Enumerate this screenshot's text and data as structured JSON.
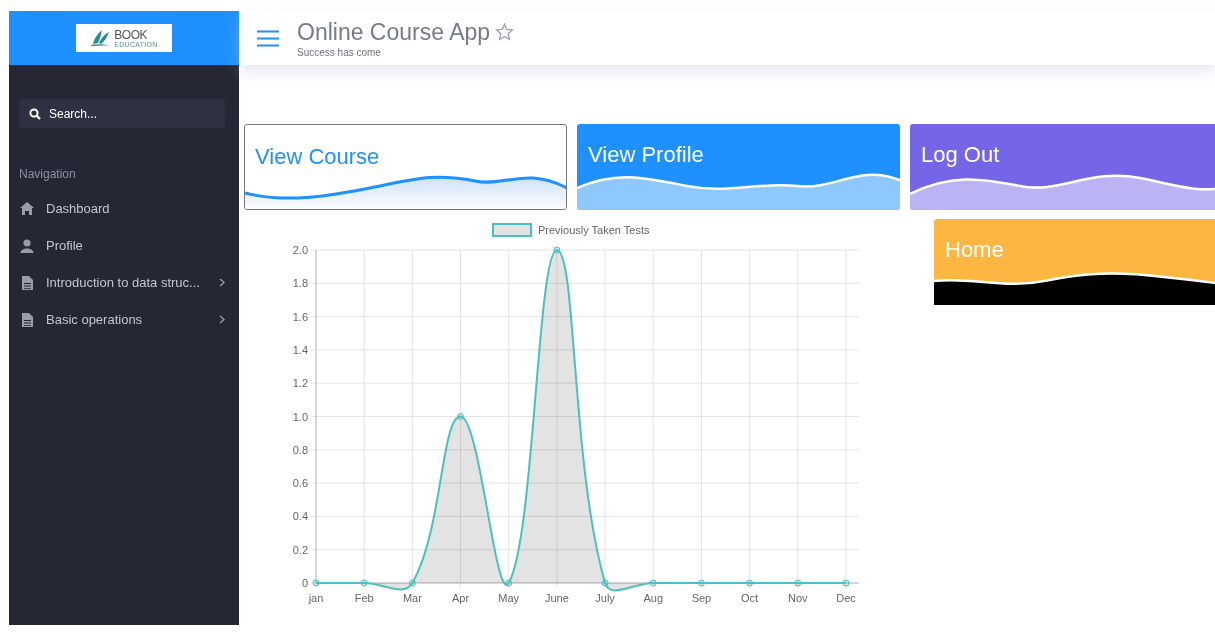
{
  "logo": {
    "title": "BOOK",
    "subtitle": "EDUCATION"
  },
  "header": {
    "title": "Online Course App",
    "subtitle": "Success has come"
  },
  "sidebar": {
    "search": {
      "placeholder": "Search..."
    },
    "section": "Navigation",
    "items": [
      {
        "label": "Dashboard",
        "kind": "link"
      },
      {
        "label": "Profile",
        "kind": "link"
      },
      {
        "label": "Introduction to data struc...",
        "kind": "submenu"
      },
      {
        "label": "Basic operations",
        "kind": "submenu"
      }
    ]
  },
  "cards": [
    {
      "title": "View Course",
      "kind": "outline",
      "color": "#1e90ff"
    },
    {
      "title": "View Profile",
      "kind": "filled",
      "color": "#1e90ff"
    },
    {
      "title": "Log Out",
      "kind": "filled",
      "color": "#7566e8"
    },
    {
      "title": "Home",
      "kind": "dark",
      "color": "#fbb741"
    }
  ],
  "chart_data": {
    "type": "area",
    "categories": [
      "jan",
      "Feb",
      "Mar",
      "Apr",
      "May",
      "June",
      "July",
      "Aug",
      "Sep",
      "Oct",
      "Nov",
      "Dec"
    ],
    "series": [
      {
        "name": "Previously Taken Tests",
        "color": "#4bc0c0",
        "values": [
          0,
          0,
          0,
          1,
          0,
          2,
          0,
          0,
          0,
          0,
          0,
          0
        ]
      }
    ],
    "grid": true,
    "ylim": [
      0,
      2
    ],
    "yticks": [
      {
        "value": 0,
        "label": "0"
      },
      {
        "value": 0.2,
        "label": "0.2"
      },
      {
        "value": 0.4,
        "label": "0.4"
      },
      {
        "value": 0.6,
        "label": "0.6"
      },
      {
        "value": 0.8,
        "label": "0.8"
      },
      {
        "value": 1,
        "label": "1.0"
      },
      {
        "value": 1.2,
        "label": "1.2"
      },
      {
        "value": 1.4,
        "label": "1.4"
      },
      {
        "value": 1.6,
        "label": "1.6"
      },
      {
        "value": 1.8,
        "label": "1.8"
      },
      {
        "value": 2,
        "label": "2.0"
      }
    ]
  }
}
